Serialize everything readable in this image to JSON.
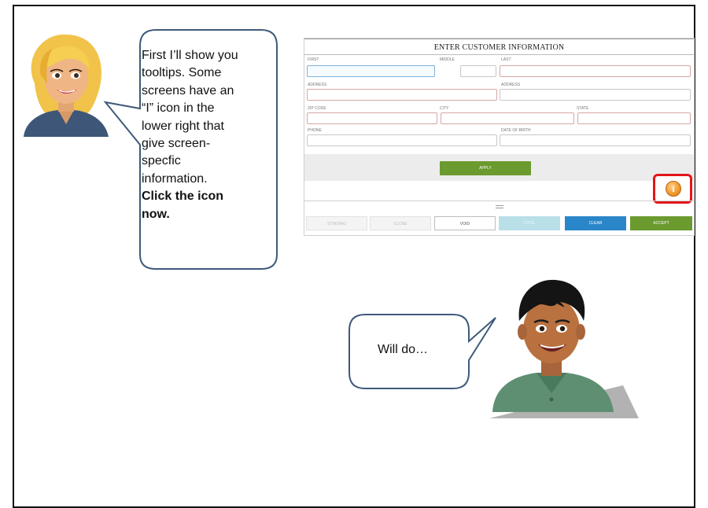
{
  "tutorial": {
    "instructor_speech_lines": [
      "First I’ll show you",
      "tooltips. Some",
      "screens have an",
      "“I” icon in the",
      "lower right that",
      "give screen-",
      "specfic",
      "information."
    ],
    "instructor_speech_bold_lines": [
      "Click the icon",
      "now."
    ],
    "student_speech": "Will do…"
  },
  "screenshot": {
    "title": "ENTER CUSTOMER INFORMATION",
    "fields": {
      "first_label": "FIRST",
      "middle_label": "MIDDLE",
      "last_label": "LAST",
      "address1_label": "ADDRESS",
      "address2_label": "ADDRESS",
      "zip_label": "ZIP CODE",
      "city_label": "CITY",
      "state_label": "STATE",
      "phone_label": "PHONE",
      "dob_label": "DATE OF BIRTH"
    },
    "apply_label": "APPLY",
    "info_icon_glyph": "i",
    "bottom_buttons": {
      "btn1": "STIM BAG",
      "btn2": "CLOSE",
      "void": "VOID",
      "total": "TOTAL",
      "clear": "CLEAR",
      "accept": "ACCEPT"
    }
  },
  "colors": {
    "highlight": "#e3161b",
    "apply_green": "#6b9a2f",
    "clear_blue": "#2a86c9",
    "bubble_border": "#3f5a7a"
  }
}
